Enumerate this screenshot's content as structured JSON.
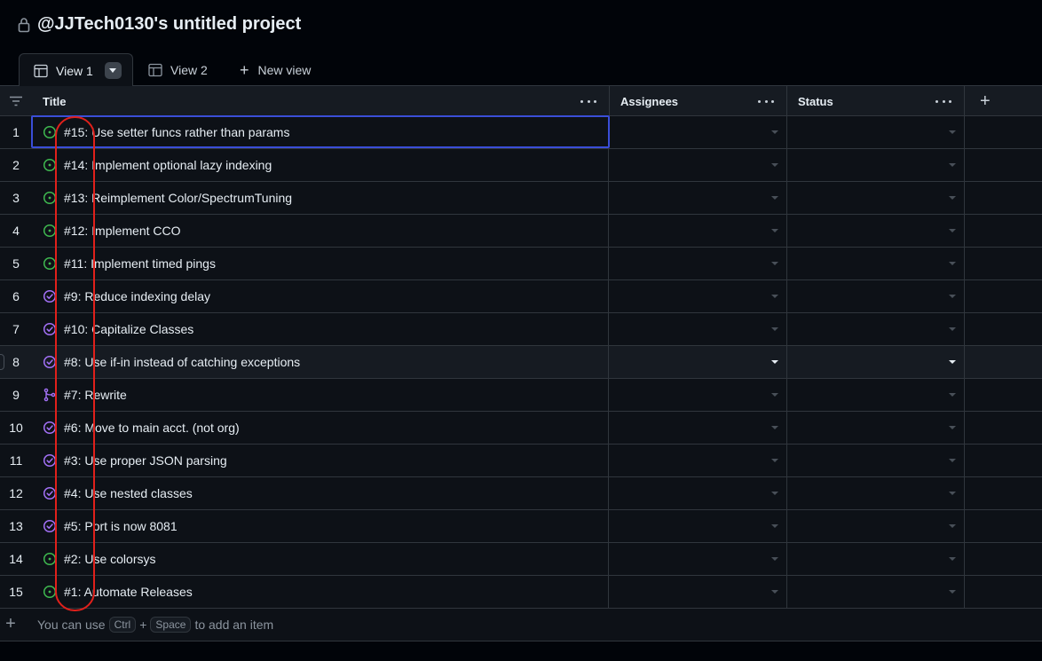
{
  "project": {
    "title": "@JJTech0130's untitled project",
    "lock_icon": "lock-icon"
  },
  "tabs": [
    {
      "label": "View 1",
      "icon": "table-icon",
      "active": true
    },
    {
      "label": "View 2",
      "icon": "table-icon",
      "active": false
    },
    {
      "label": "New view",
      "icon": "plus-icon",
      "active": false
    }
  ],
  "columns": {
    "title": "Title",
    "assignees": "Assignees",
    "status": "Status",
    "add": "+"
  },
  "rows": [
    {
      "num": "1",
      "title": "#15: Use setter funcs rather than params",
      "icon": "open-issue-icon"
    },
    {
      "num": "2",
      "title": "#14: Implement optional lazy indexing",
      "icon": "open-issue-icon"
    },
    {
      "num": "3",
      "title": "#13: Reimplement Color/SpectrumTuning",
      "icon": "open-issue-icon"
    },
    {
      "num": "4",
      "title": "#12: Implement CCO",
      "icon": "open-issue-icon"
    },
    {
      "num": "5",
      "title": "#11: Implement timed pings",
      "icon": "open-issue-icon"
    },
    {
      "num": "6",
      "title": "#9: Reduce indexing delay",
      "icon": "closed-issue-icon"
    },
    {
      "num": "7",
      "title": "#10: Capitalize Classes",
      "icon": "closed-issue-icon"
    },
    {
      "num": "8",
      "title": "#8: Use if-in instead of catching exceptions",
      "icon": "closed-issue-icon"
    },
    {
      "num": "9",
      "title": "#7: Rewrite",
      "icon": "merged-pr-icon"
    },
    {
      "num": "10",
      "title": "#6: Move to main acct. (not org)",
      "icon": "closed-issue-icon"
    },
    {
      "num": "11",
      "title": "#3: Use proper JSON parsing",
      "icon": "closed-issue-icon"
    },
    {
      "num": "12",
      "title": "#4: Use nested classes",
      "icon": "closed-issue-icon"
    },
    {
      "num": "13",
      "title": "#5: Port is now 8081",
      "icon": "closed-issue-icon"
    },
    {
      "num": "14",
      "title": "#2: Use colorsys",
      "icon": "open-issue-icon"
    },
    {
      "num": "15",
      "title": "#1: Automate Releases",
      "icon": "open-issue-icon"
    }
  ],
  "footer": {
    "text_before": "You can use",
    "key1": "Ctrl",
    "plus": "+",
    "key2": "Space",
    "text_after": "to add an item"
  },
  "colors": {
    "open": "#3fb950",
    "closed": "#a371f7",
    "merged": "#a371f7",
    "selection": "#3a4ed8",
    "annotation": "#e0201b"
  }
}
